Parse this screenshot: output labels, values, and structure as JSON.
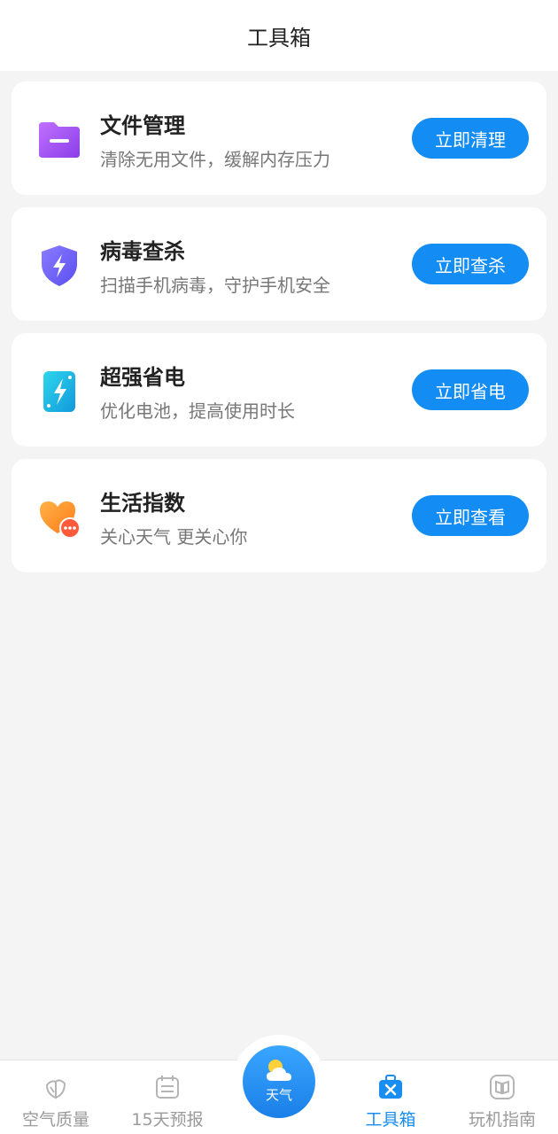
{
  "header": {
    "title": "工具箱"
  },
  "tools": [
    {
      "name": "文件管理",
      "desc": "清除无用文件，缓解内存压力",
      "action": "立即清理",
      "icon": "folder-icon",
      "color": "#9b4df0"
    },
    {
      "name": "病毒查杀",
      "desc": "扫描手机病毒，守护手机安全",
      "action": "立即查杀",
      "icon": "shield-bolt-icon",
      "color": "#6c63f2"
    },
    {
      "name": "超强省电",
      "desc": "优化电池，提高使用时长",
      "action": "立即省电",
      "icon": "battery-bolt-icon",
      "color": "#16b3e3"
    },
    {
      "name": "生活指数",
      "desc": "关心天气 更关心你",
      "action": "立即查看",
      "icon": "heart-chat-icon",
      "color": "#ff8a2a"
    }
  ],
  "tabbar": {
    "items": [
      {
        "label": "空气质量",
        "icon": "leaf-icon",
        "active": false
      },
      {
        "label": "15天预报",
        "icon": "calendar-icon",
        "active": false
      },
      {
        "label": "天气",
        "icon": "weather-sun-cloud-icon",
        "active": false
      },
      {
        "label": "工具箱",
        "icon": "toolbox-icon",
        "active": true
      },
      {
        "label": "玩机指南",
        "icon": "book-icon",
        "active": false
      }
    ]
  },
  "colors": {
    "accent": "#138cf3",
    "background": "#f4f4f4",
    "active_tab": "#1a8ef0"
  }
}
